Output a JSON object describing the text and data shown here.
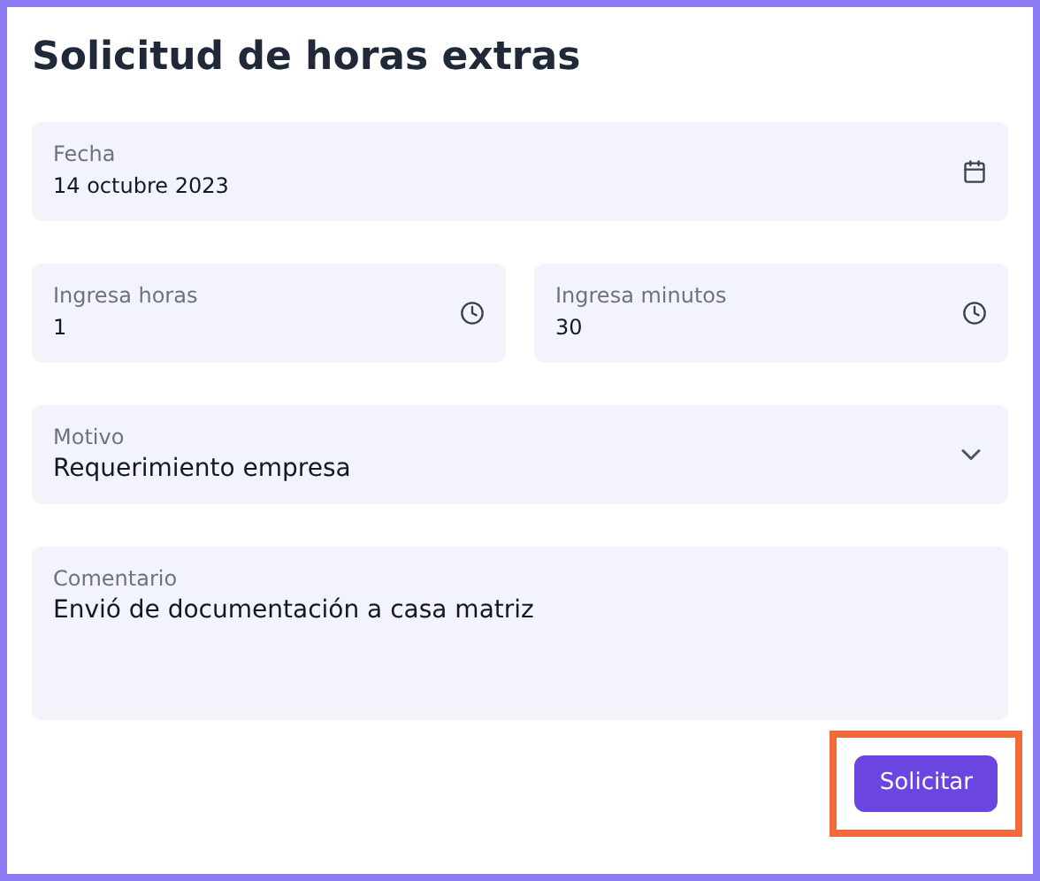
{
  "title": "Solicitud de horas extras",
  "fields": [
    {
      "kind": "date",
      "label": "Fecha",
      "value": "14 octubre 2023"
    },
    {
      "kind": "time",
      "label": "Ingresa horas",
      "value": "1"
    },
    {
      "kind": "time",
      "label": "Ingresa minutos",
      "value": "30"
    },
    {
      "kind": "select",
      "label": "Motivo",
      "value": "Requerimiento empresa"
    },
    {
      "kind": "textarea",
      "label": "Comentario",
      "value": "Envió de documentación a casa matriz"
    }
  ],
  "submit": {
    "label": "Solicitar",
    "highlighted": true
  }
}
